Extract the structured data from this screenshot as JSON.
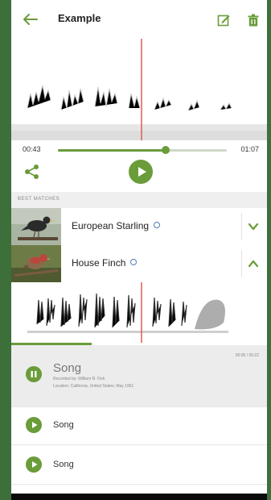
{
  "app": {
    "title": "Example"
  },
  "playback": {
    "elapsed": "00:43",
    "duration": "01:07",
    "progress": 0.64
  },
  "section": {
    "best_matches_label": "BEST MATCHES"
  },
  "matches": [
    {
      "name": "European Starling",
      "expanded": false
    },
    {
      "name": "House Finch",
      "expanded": true
    }
  ],
  "recordings": [
    {
      "title": "Song",
      "state": "playing",
      "time": "00:05 / 00:22",
      "recorded_by": "Recorded by: William R. Fish",
      "location": "Location: California, United States, May 1951"
    },
    {
      "title": "Song",
      "state": "paused"
    },
    {
      "title": "Song",
      "state": "paused"
    }
  ],
  "colors": {
    "accent": "#6a9c3a",
    "playhead": "#e15b55",
    "background": "#3c6f3a"
  },
  "icons": [
    "back-arrow-icon",
    "edit-icon",
    "trash-icon",
    "share-icon",
    "play-icon",
    "pause-icon",
    "info-icon",
    "chevron-down-icon",
    "chevron-up-icon"
  ]
}
